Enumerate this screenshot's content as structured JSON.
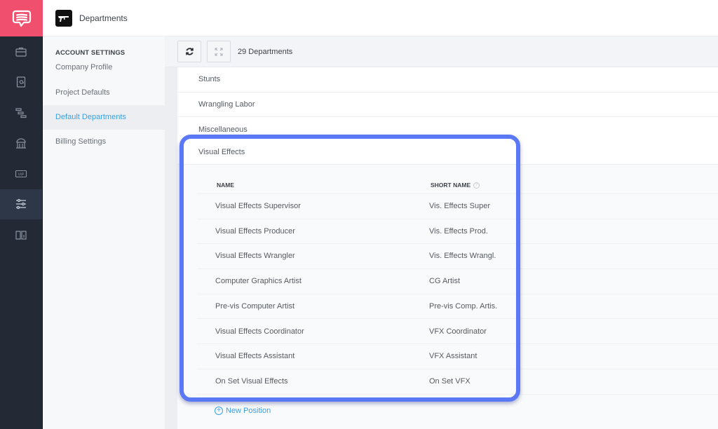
{
  "app": {
    "brand_color": "#f0506e",
    "accent_color": "#3aa0e6",
    "highlight_color": "#5b79f7"
  },
  "rail": {
    "logo_icon": "chat-bubble-icon",
    "items": [
      {
        "icon": "briefcase-icon",
        "active": false
      },
      {
        "icon": "contact-book-icon",
        "active": false
      },
      {
        "icon": "gantt-icon",
        "active": false
      },
      {
        "icon": "building-icon",
        "active": false
      },
      {
        "icon": "vip-icon",
        "active": false
      },
      {
        "icon": "sliders-icon",
        "active": true
      },
      {
        "icon": "info-book-icon",
        "active": false
      }
    ]
  },
  "header": {
    "icon": "rifle-icon",
    "title": "Departments"
  },
  "settings_nav": {
    "heading": "ACCOUNT SETTINGS",
    "items": [
      {
        "label": "Company Profile",
        "active": false
      },
      {
        "label": "Project Defaults",
        "active": false
      },
      {
        "label": "Default Departments",
        "active": true
      },
      {
        "label": "Billing Settings",
        "active": false
      }
    ]
  },
  "toolbar": {
    "refresh_icon": "refresh-icon",
    "expand_icon": "expand-icon",
    "count_label": "29 Departments"
  },
  "departments": [
    {
      "name": "Stunts"
    },
    {
      "name": "Wrangling Labor"
    },
    {
      "name": "Miscellaneous"
    },
    {
      "name": "Visual Effects",
      "expanded": true
    }
  ],
  "positions": {
    "columns": {
      "name": "NAME",
      "short_name": "SHORT NAME"
    },
    "rows": [
      {
        "name": "Visual Effects Supervisor",
        "short_name": "Vis. Effects Super"
      },
      {
        "name": "Visual Effects Producer",
        "short_name": "Vis. Effects Prod."
      },
      {
        "name": "Visual Effects Wrangler",
        "short_name": "Vis. Effects Wrangl."
      },
      {
        "name": "Computer Graphics Artist",
        "short_name": "CG Artist"
      },
      {
        "name": "Pre-vis Computer Artist",
        "short_name": "Pre-vis Comp. Artis."
      },
      {
        "name": "Visual Effects Coordinator",
        "short_name": "VFX Coordinator"
      },
      {
        "name": "Visual Effects Assistant",
        "short_name": "VFX Assistant"
      },
      {
        "name": "On Set Visual Effects",
        "short_name": "On Set VFX"
      }
    ],
    "new_position_label": "New Position",
    "help_glyph": "?",
    "plus_glyph": "+"
  }
}
